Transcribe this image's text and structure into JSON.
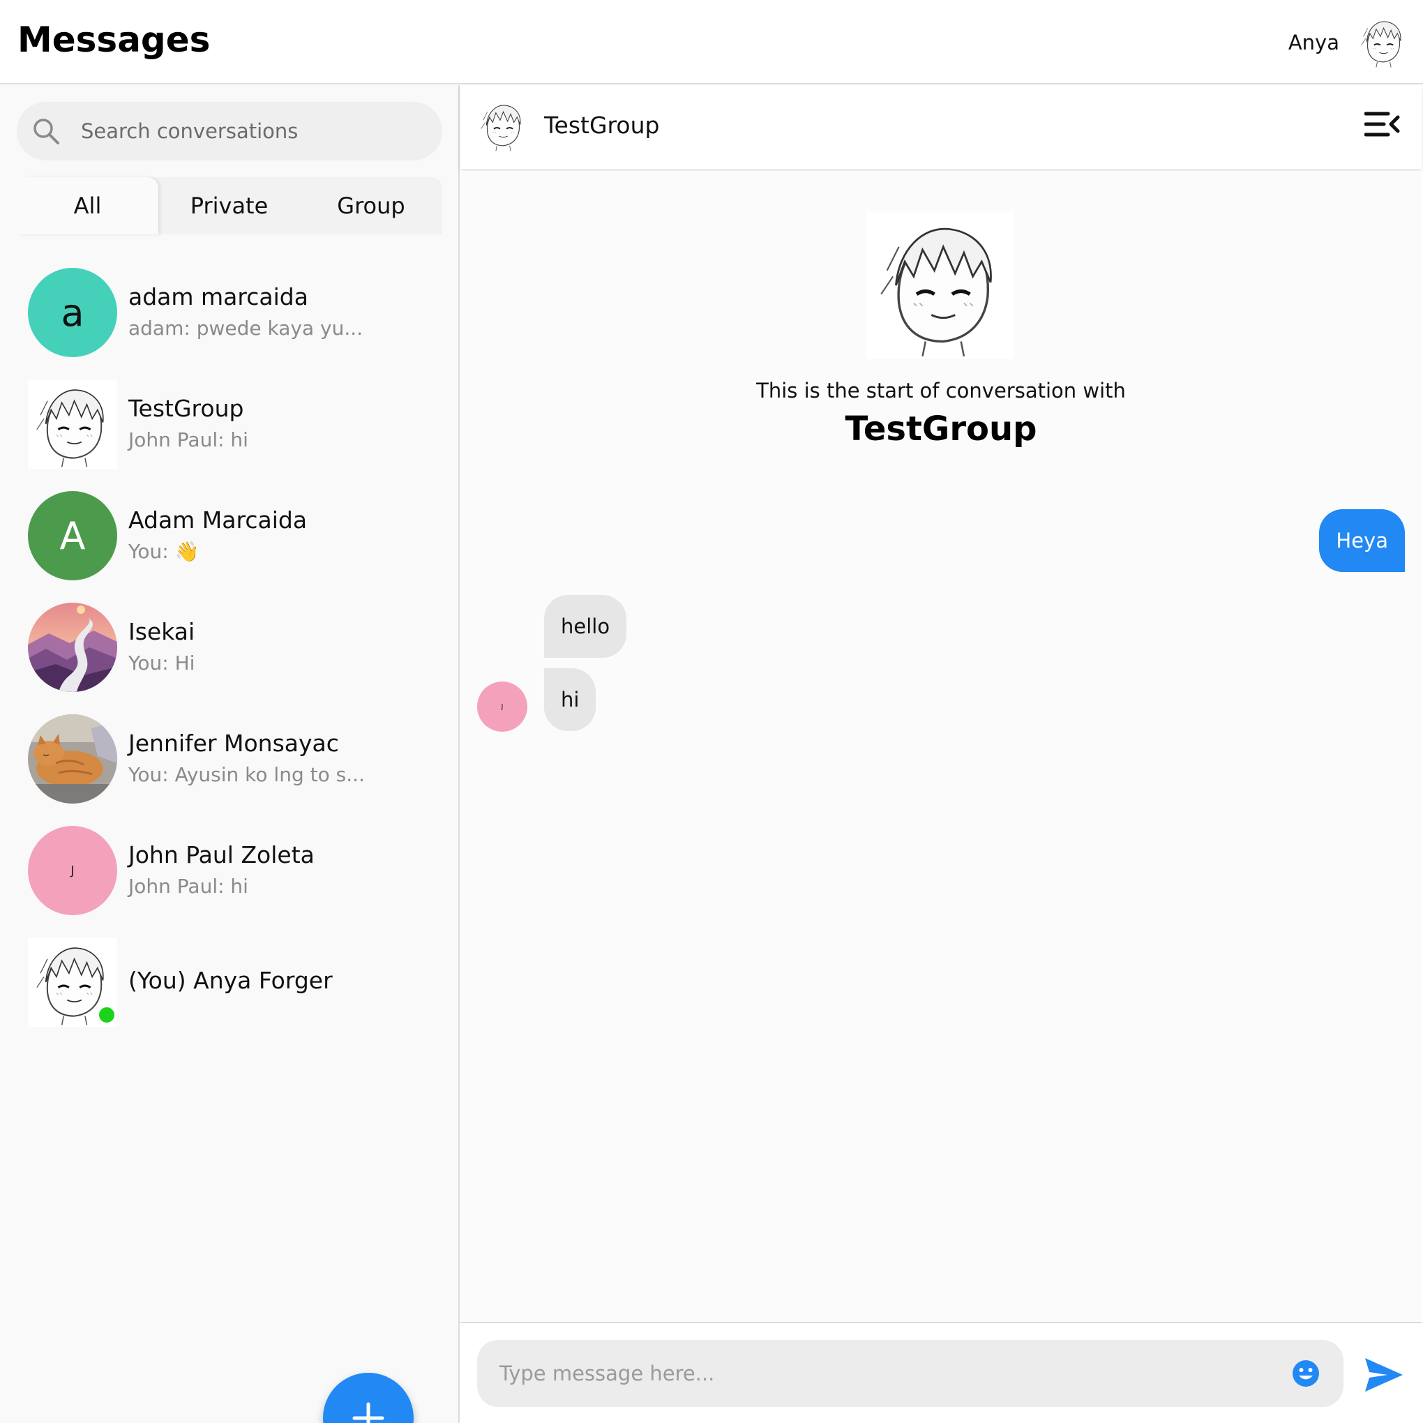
{
  "app": {
    "title": "Messages",
    "user_name": "Anya"
  },
  "search": {
    "placeholder": "Search conversations"
  },
  "tabs": [
    {
      "label": "All",
      "active": true
    },
    {
      "label": "Private",
      "active": false
    },
    {
      "label": "Group",
      "active": false
    }
  ],
  "conversations": [
    {
      "name": "adam marcaida",
      "preview": "adam: pwede kaya yu...",
      "avatar_type": "letter",
      "avatar_letter": "a",
      "avatar_color": "#45d0b9"
    },
    {
      "name": "TestGroup",
      "preview": "John Paul: hi",
      "avatar_type": "sketch"
    },
    {
      "name": "Adam Marcaida",
      "preview": "You: 👋",
      "avatar_type": "letter",
      "avatar_letter": "A",
      "avatar_color": "#4c9b4c"
    },
    {
      "name": "Isekai",
      "preview": "You: Hi",
      "avatar_type": "landscape-photo"
    },
    {
      "name": "Jennifer Monsayac",
      "preview": "You: Ayusin ko lng to s...",
      "avatar_type": "cat-photo"
    },
    {
      "name": "John Paul Zoleta",
      "preview": "John Paul: hi",
      "avatar_type": "letter",
      "avatar_letter": "J",
      "avatar_color": "#f4a1bb"
    },
    {
      "name": "(You) Anya Forger",
      "preview": "",
      "avatar_type": "sketch",
      "online": true
    }
  ],
  "chat": {
    "title": "TestGroup",
    "intro_text": "This is the start of conversation with",
    "intro_name": "TestGroup",
    "messages": [
      {
        "direction": "out",
        "text": "Heya"
      },
      {
        "direction": "in",
        "text": "hello"
      },
      {
        "direction": "in",
        "text": "hi",
        "sender_initial": "J"
      }
    ]
  },
  "composer": {
    "placeholder": "Type message here..."
  },
  "colors": {
    "accent": "#2188f4",
    "online": "#1cd31c"
  },
  "icons": [
    "search-icon",
    "menu-collapse-icon",
    "plus-icon",
    "emoji-icon",
    "send-icon"
  ]
}
